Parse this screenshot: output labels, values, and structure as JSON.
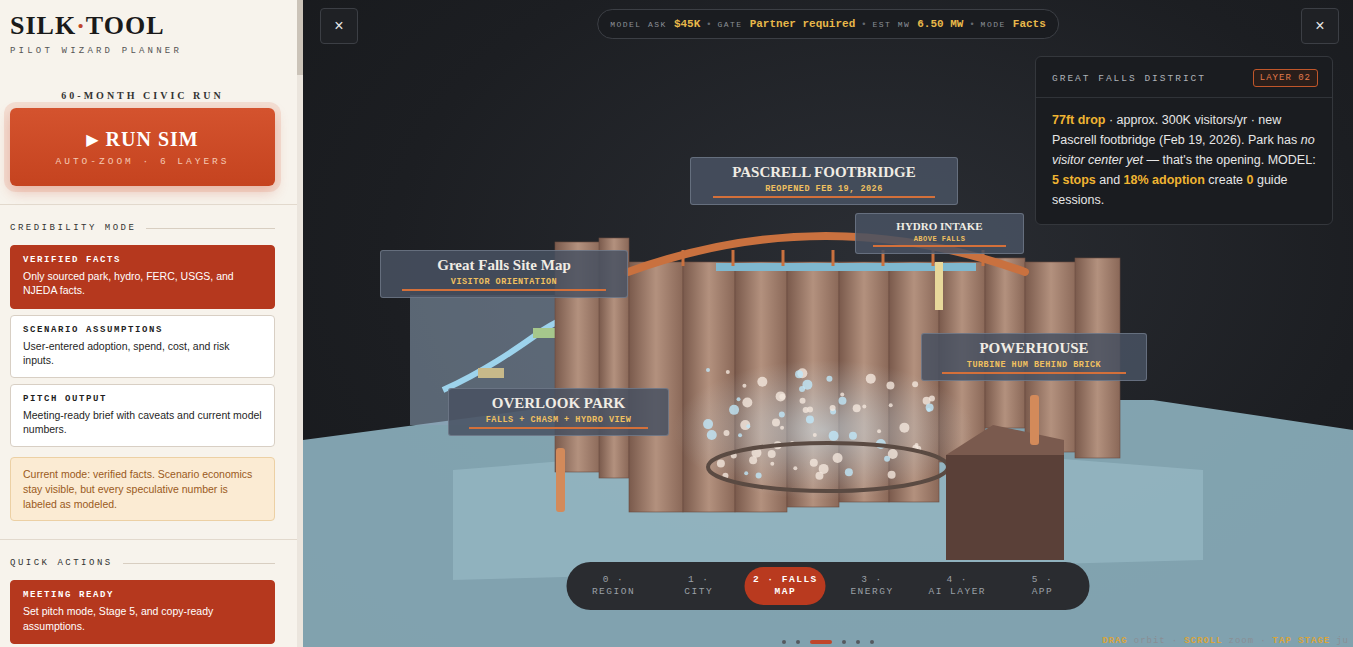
{
  "sidebar": {
    "logo": {
      "before": "SILK",
      "mark": "·",
      "after": "TOOL"
    },
    "subtitle": "PILOT WIZARD PLANNER",
    "run_caption": "60-MONTH CIVIC RUN",
    "run_button": {
      "icon": "▶",
      "label": "RUN SIM",
      "sub": "AUTO-ZOOM · 6 LAYERS"
    },
    "credibility": {
      "heading": "CREDIBILITY MODE",
      "options": [
        {
          "title": "VERIFIED FACTS",
          "description": "Only sourced park, hydro, FERC, USGS, and NJEDA facts.",
          "selected": true
        },
        {
          "title": "SCENARIO ASSUMPTIONS",
          "description": "User-entered adoption, spend, cost, and risk inputs.",
          "selected": false
        },
        {
          "title": "PITCH OUTPUT",
          "description": "Meeting-ready brief with caveats and current model numbers.",
          "selected": false
        }
      ],
      "note": "Current mode: verified facts. Scenario economics stay visible, but every speculative number is labeled as modeled."
    },
    "quick_actions": {
      "heading": "QUICK ACTIONS",
      "items": [
        {
          "title": "MEETING READY",
          "description": "Set pitch mode, Stage 5, and copy-ready assumptions.",
          "kind": "primary"
        }
      ]
    }
  },
  "toolbar": {
    "close_left": "×",
    "close_right": "×",
    "separator": "•",
    "status": [
      {
        "label": "MODEL ASK",
        "value": "$45K"
      },
      {
        "label": "GATE",
        "value": "Partner required"
      },
      {
        "label": "EST MW",
        "value": "6.50 MW"
      },
      {
        "label": "MODE",
        "value": "Facts"
      }
    ]
  },
  "info_card": {
    "title": "GREAT FALLS DISTRICT",
    "badge": "LAYER 02",
    "body": [
      {
        "text": "77ft drop",
        "style": "highlight"
      },
      {
        "text": " · approx. 300K visitors/yr · new Pascrell footbridge (Feb 19, 2026). Park has ",
        "style": "plain"
      },
      {
        "text": "no visitor center yet",
        "style": "italic"
      },
      {
        "text": " — that's the opening. MODEL: ",
        "style": "plain"
      },
      {
        "text": "5 stops",
        "style": "highlight"
      },
      {
        "text": " and ",
        "style": "plain"
      },
      {
        "text": "18% adoption",
        "style": "highlight"
      },
      {
        "text": " create ",
        "style": "plain"
      },
      {
        "text": "0",
        "style": "highlight"
      },
      {
        "text": " guide sessions.",
        "style": "plain"
      }
    ]
  },
  "scene_labels": [
    {
      "title": "PASCRELL FOOTBRIDGE",
      "sub": "REOPENED FEB 19, 2026",
      "kind": "large"
    },
    {
      "title": "HYDRO INTAKE",
      "sub": "ABOVE FALLS",
      "kind": "small"
    },
    {
      "title": "Great Falls Site Map",
      "sub": "VISITOR ORIENTATION",
      "kind": "large"
    },
    {
      "title": "OVERLOOK PARK",
      "sub": "FALLS + CHASM + HYDRO VIEW",
      "kind": "large"
    },
    {
      "title": "POWERHOUSE",
      "sub": "TURBINE HUM BEHIND BRICK",
      "kind": "large"
    }
  ],
  "stage_nav": [
    {
      "lines": [
        "0 ·",
        "REGION"
      ],
      "selected": false
    },
    {
      "lines": [
        "1 ·",
        "CITY"
      ],
      "selected": false
    },
    {
      "lines": [
        "2 · FALLS",
        "MAP"
      ],
      "selected": true
    },
    {
      "lines": [
        "3 ·",
        "ENERGY"
      ],
      "selected": false
    },
    {
      "lines": [
        "4 ·",
        "AI LAYER"
      ],
      "selected": false
    },
    {
      "lines": [
        "5 ·",
        "APP"
      ],
      "selected": false
    }
  ],
  "stage_dots": [
    {
      "selected": false
    },
    {
      "selected": false
    },
    {
      "selected": true
    },
    {
      "selected": false
    },
    {
      "selected": false
    },
    {
      "selected": false
    }
  ],
  "hints": [
    {
      "text": "DRAG",
      "style": "key"
    },
    {
      "text": "orbit",
      "style": "plain"
    },
    {
      "text": "·",
      "style": "plain"
    },
    {
      "text": "SCROLL",
      "style": "key"
    },
    {
      "text": "zoom",
      "style": "plain"
    },
    {
      "text": "·",
      "style": "plain"
    },
    {
      "text": "TAP STAGE",
      "style": "key"
    },
    {
      "text": "ju",
      "style": "plain"
    }
  ]
}
